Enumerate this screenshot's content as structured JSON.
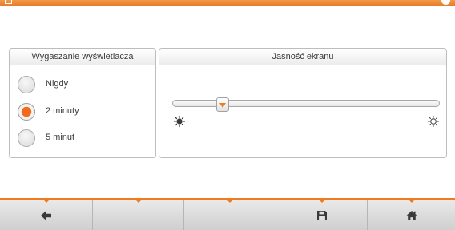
{
  "display_timeout": {
    "title": "Wygaszanie wyświetlacza",
    "options": [
      {
        "label": "Nigdy",
        "selected": false
      },
      {
        "label": "2 minuty",
        "selected": true
      },
      {
        "label": "5 minut",
        "selected": false
      }
    ]
  },
  "brightness": {
    "title": "Jasność ekranu",
    "level_fraction": 0.19,
    "min_icon": "sun-dim-icon",
    "max_icon": "sun-bright-icon"
  },
  "footer": {
    "buttons": [
      {
        "icon": "back-arrow-icon"
      },
      {
        "icon": ""
      },
      {
        "icon": ""
      },
      {
        "icon": "save-icon"
      },
      {
        "icon": "home-icon"
      }
    ]
  },
  "colors": {
    "accent": "#f07a1e",
    "panel_border": "#bdbdbd",
    "footer_bg": "#dcdcdc",
    "icon": "#4a4a4a"
  }
}
